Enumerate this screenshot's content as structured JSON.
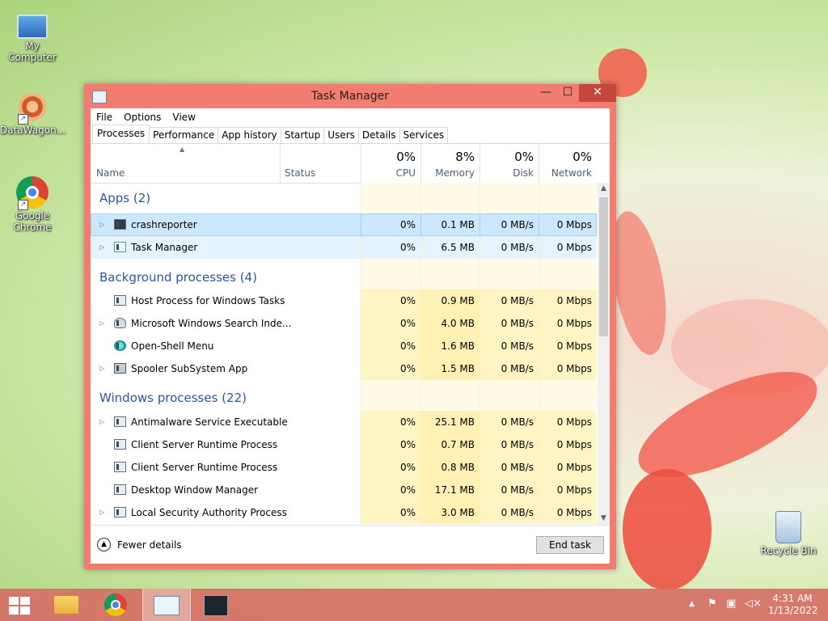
{
  "desktop": {
    "icons": [
      {
        "label": "My Computer"
      },
      {
        "label": "DataWagon..."
      },
      {
        "label": "Google Chrome"
      },
      {
        "label": "Recycle Bin"
      }
    ]
  },
  "window": {
    "title": "Task Manager",
    "controls": {
      "minimize": "—",
      "maximize": "☐",
      "close": "✕"
    }
  },
  "menubar": [
    "File",
    "Options",
    "View"
  ],
  "tabs": [
    "Processes",
    "Performance",
    "App history",
    "Startup",
    "Users",
    "Details",
    "Services"
  ],
  "columns": {
    "name": "Name",
    "status": "Status",
    "cpu": {
      "pct": "0%",
      "label": "CPU"
    },
    "memory": {
      "pct": "8%",
      "label": "Memory"
    },
    "disk": {
      "pct": "0%",
      "label": "Disk"
    },
    "network": {
      "pct": "0%",
      "label": "Network"
    }
  },
  "groups": {
    "apps": "Apps (2)",
    "background": "Background processes (4)",
    "windows": "Windows processes (22)"
  },
  "apps": [
    {
      "name": "crashreporter",
      "cpu": "0%",
      "mem": "0.1 MB",
      "disk": "0 MB/s",
      "net": "0 Mbps"
    },
    {
      "name": "Task Manager",
      "cpu": "0%",
      "mem": "6.5 MB",
      "disk": "0 MB/s",
      "net": "0 Mbps"
    }
  ],
  "background": [
    {
      "name": "Host Process for Windows Tasks",
      "cpu": "0%",
      "mem": "0.9 MB",
      "disk": "0 MB/s",
      "net": "0 Mbps"
    },
    {
      "name": "Microsoft Windows Search Inde...",
      "cpu": "0%",
      "mem": "4.0 MB",
      "disk": "0 MB/s",
      "net": "0 Mbps"
    },
    {
      "name": "Open-Shell Menu",
      "cpu": "0%",
      "mem": "1.6 MB",
      "disk": "0 MB/s",
      "net": "0 Mbps"
    },
    {
      "name": "Spooler SubSystem App",
      "cpu": "0%",
      "mem": "1.5 MB",
      "disk": "0 MB/s",
      "net": "0 Mbps"
    }
  ],
  "windows": [
    {
      "name": "Antimalware Service Executable",
      "cpu": "0%",
      "mem": "25.1 MB",
      "disk": "0 MB/s",
      "net": "0 Mbps"
    },
    {
      "name": "Client Server Runtime Process",
      "cpu": "0%",
      "mem": "0.7 MB",
      "disk": "0 MB/s",
      "net": "0 Mbps"
    },
    {
      "name": "Client Server Runtime Process",
      "cpu": "0%",
      "mem": "0.8 MB",
      "disk": "0 MB/s",
      "net": "0 Mbps"
    },
    {
      "name": "Desktop Window Manager",
      "cpu": "0%",
      "mem": "17.1 MB",
      "disk": "0 MB/s",
      "net": "0 Mbps"
    },
    {
      "name": "Local Security Authority Process",
      "cpu": "0%",
      "mem": "3.0 MB",
      "disk": "0 MB/s",
      "net": "0 Mbps"
    }
  ],
  "footer": {
    "fewer_details": "Fewer details",
    "end_task": "End task"
  },
  "taskbar": {
    "clock_time": "4:31 AM",
    "clock_date": "1/13/2022"
  }
}
